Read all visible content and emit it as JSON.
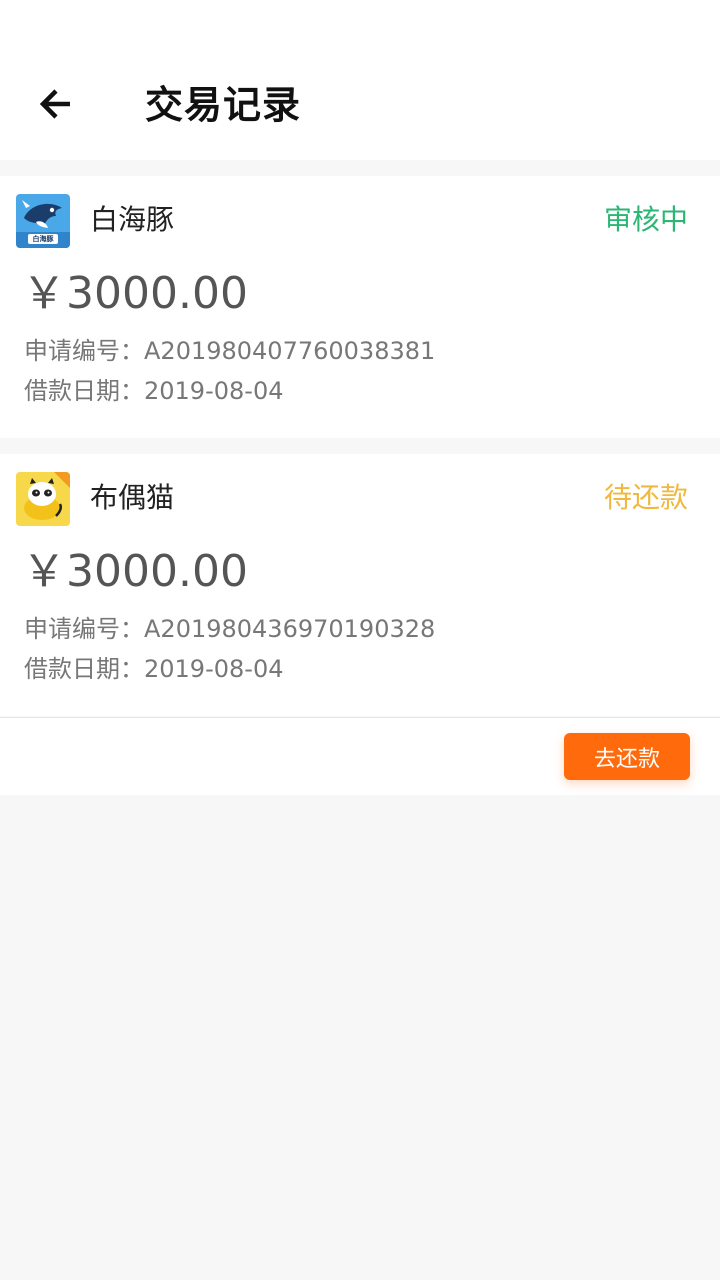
{
  "header": {
    "title": "交易记录",
    "back_icon": "arrow-left-icon"
  },
  "records": [
    {
      "logo": "beluga-logo",
      "logo_caption": "白海豚",
      "name": "白海豚",
      "status": "审核中",
      "status_color": "#2bb673",
      "amount": "￥3000.00",
      "application_no_label": "申请编号：",
      "application_no": "A201980407760038381",
      "loan_date_label": "借款日期：",
      "loan_date": "2019-08-04"
    },
    {
      "logo": "rag-doll-cat-logo",
      "name": "布偶猫",
      "status": "待还款",
      "status_color": "#f0b83c",
      "amount": "￥3000.00",
      "application_no_label": "申请编号：",
      "application_no": "A201980436970190328",
      "loan_date_label": "借款日期：",
      "loan_date": "2019-08-04"
    }
  ],
  "actions": {
    "repay_label": "去还款",
    "repay_color": "#ff6a0c"
  }
}
